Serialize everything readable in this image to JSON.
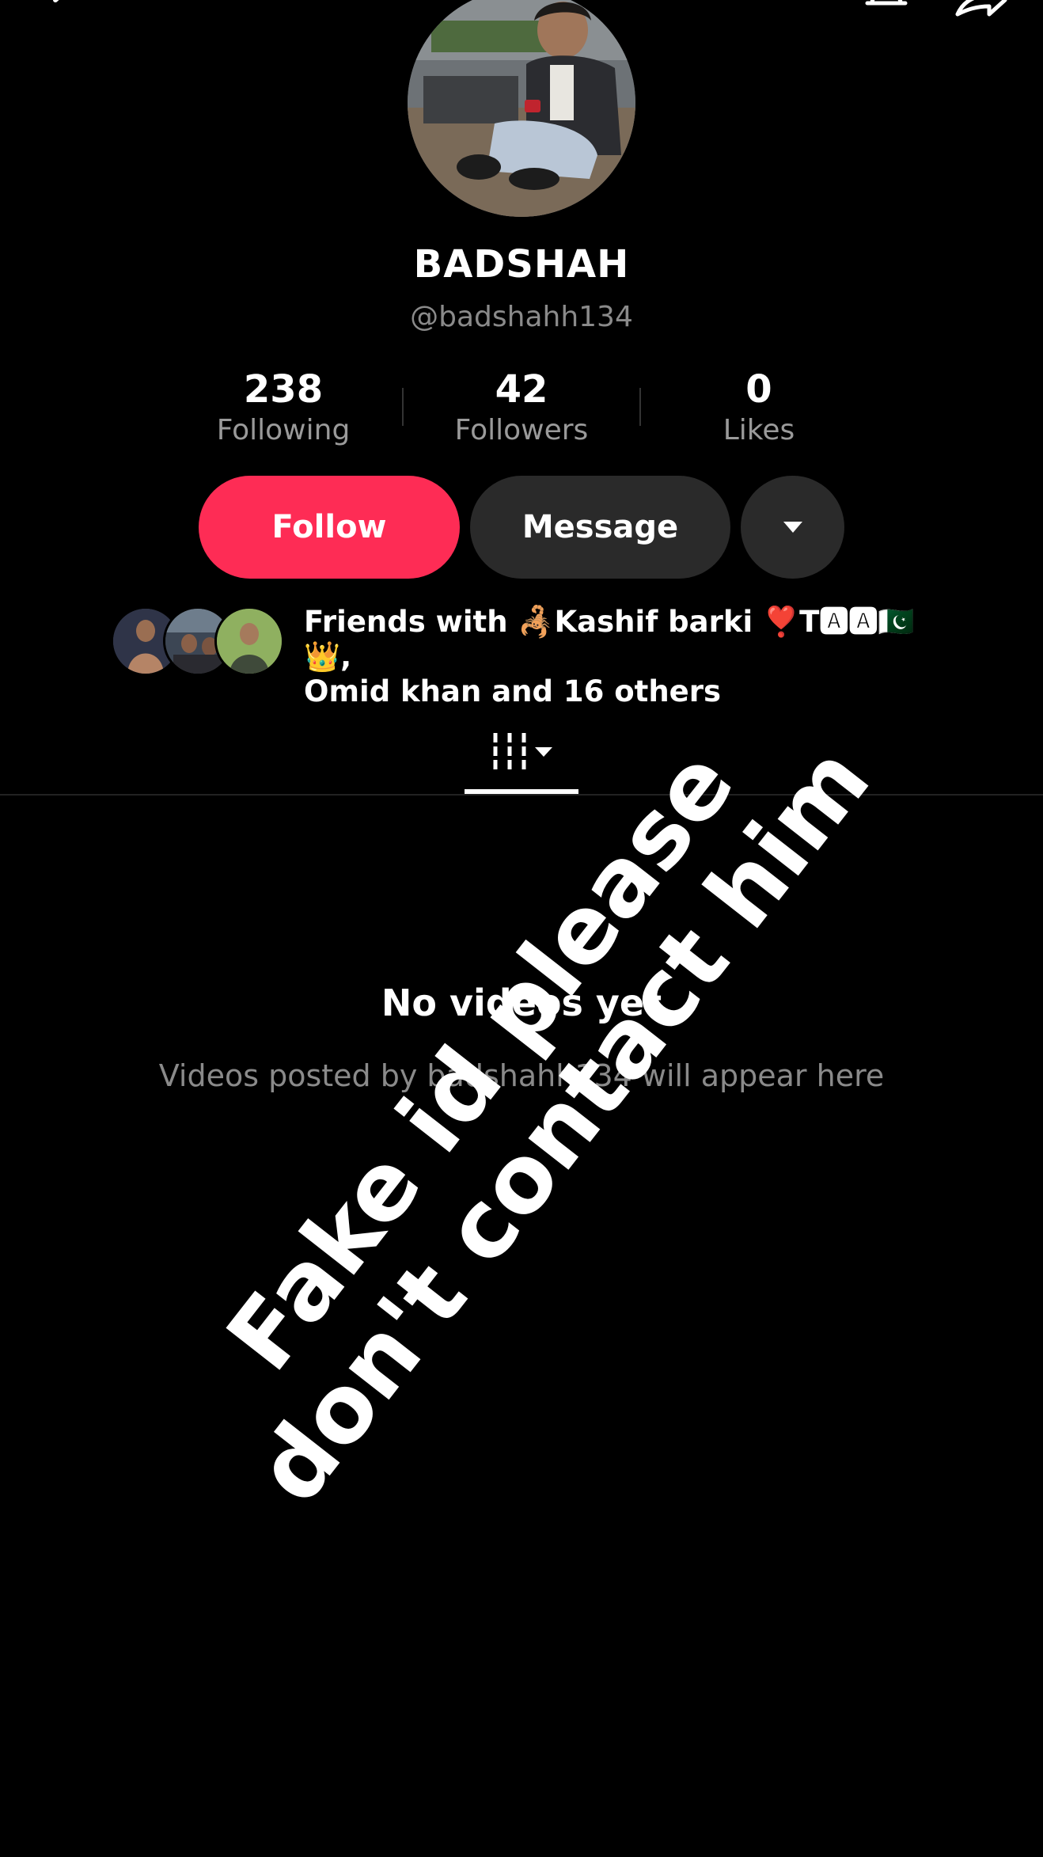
{
  "profile": {
    "display_name": "BADSHAH",
    "handle": "@badshahh134"
  },
  "stats": {
    "following_count": "238",
    "following_label": "Following",
    "followers_count": "42",
    "followers_label": "Followers",
    "likes_count": "0",
    "likes_label": "Likes"
  },
  "actions": {
    "follow_label": "Follow",
    "message_label": "Message"
  },
  "friends": {
    "line1": "Friends with 🦂Kashif barki ❣️T🅰🅰🇵🇰👑,",
    "line2": "Omid khan and 16 others"
  },
  "empty_state": {
    "title": "No videos yet",
    "subtitle": "Videos posted by badshahh134 will appear here"
  },
  "overlay": {
    "text": "Fake id please don't contact him"
  },
  "colors": {
    "follow_button": "#fe2c55",
    "secondary_button": "#2a2a2a",
    "background": "#000000"
  },
  "icons": [
    "back-icon",
    "bell-icon",
    "share-icon",
    "dropdown-icon",
    "grid-icon"
  ]
}
